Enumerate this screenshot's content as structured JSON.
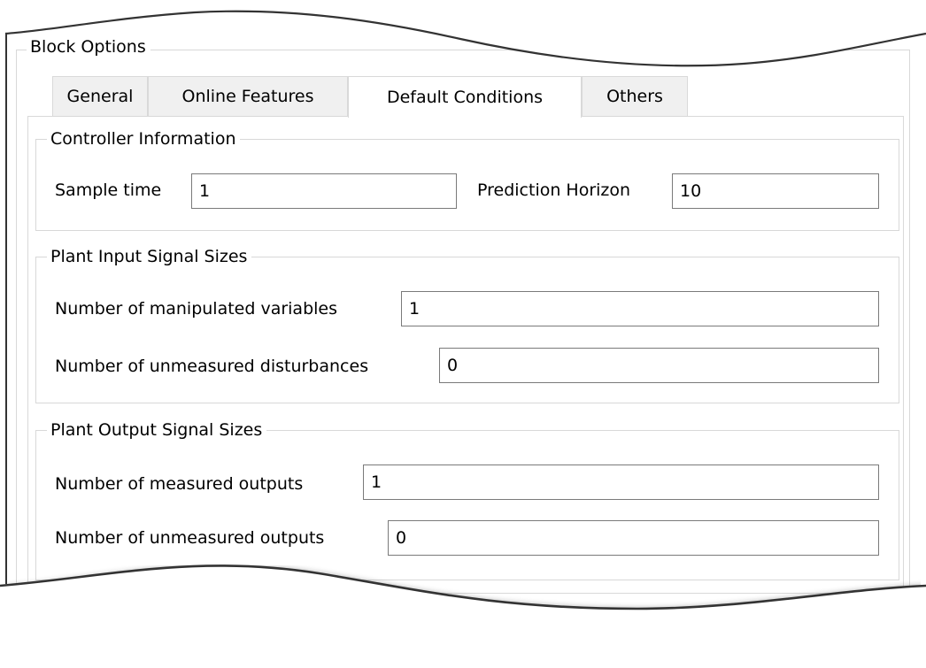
{
  "block_options": {
    "title": "Block Options"
  },
  "tabs": [
    {
      "label": "General",
      "active": false
    },
    {
      "label": "Online Features",
      "active": false
    },
    {
      "label": "Default Conditions",
      "active": true
    },
    {
      "label": "Others",
      "active": false
    }
  ],
  "controller_information": {
    "title": "Controller Information",
    "sample_time_label": "Sample time",
    "sample_time_value": "1",
    "prediction_horizon_label": "Prediction Horizon",
    "prediction_horizon_value": "10"
  },
  "plant_input_signal_sizes": {
    "title": "Plant Input Signal Sizes",
    "manipulated_label": "Number of manipulated variables",
    "manipulated_value": "1",
    "unmeasured_disturbances_label": "Number of unmeasured disturbances",
    "unmeasured_disturbances_value": "0"
  },
  "plant_output_signal_sizes": {
    "title": "Plant Output Signal Sizes",
    "measured_outputs_label": "Number of measured outputs",
    "measured_outputs_value": "1",
    "unmeasured_outputs_label": "Number of unmeasured outputs",
    "unmeasured_outputs_value": "0"
  },
  "colors": {
    "tab_inactive_bg": "#f0f0f0",
    "border": "#d9d9d9",
    "input_border": "#7a7a7a",
    "frame_edge": "#333333"
  }
}
